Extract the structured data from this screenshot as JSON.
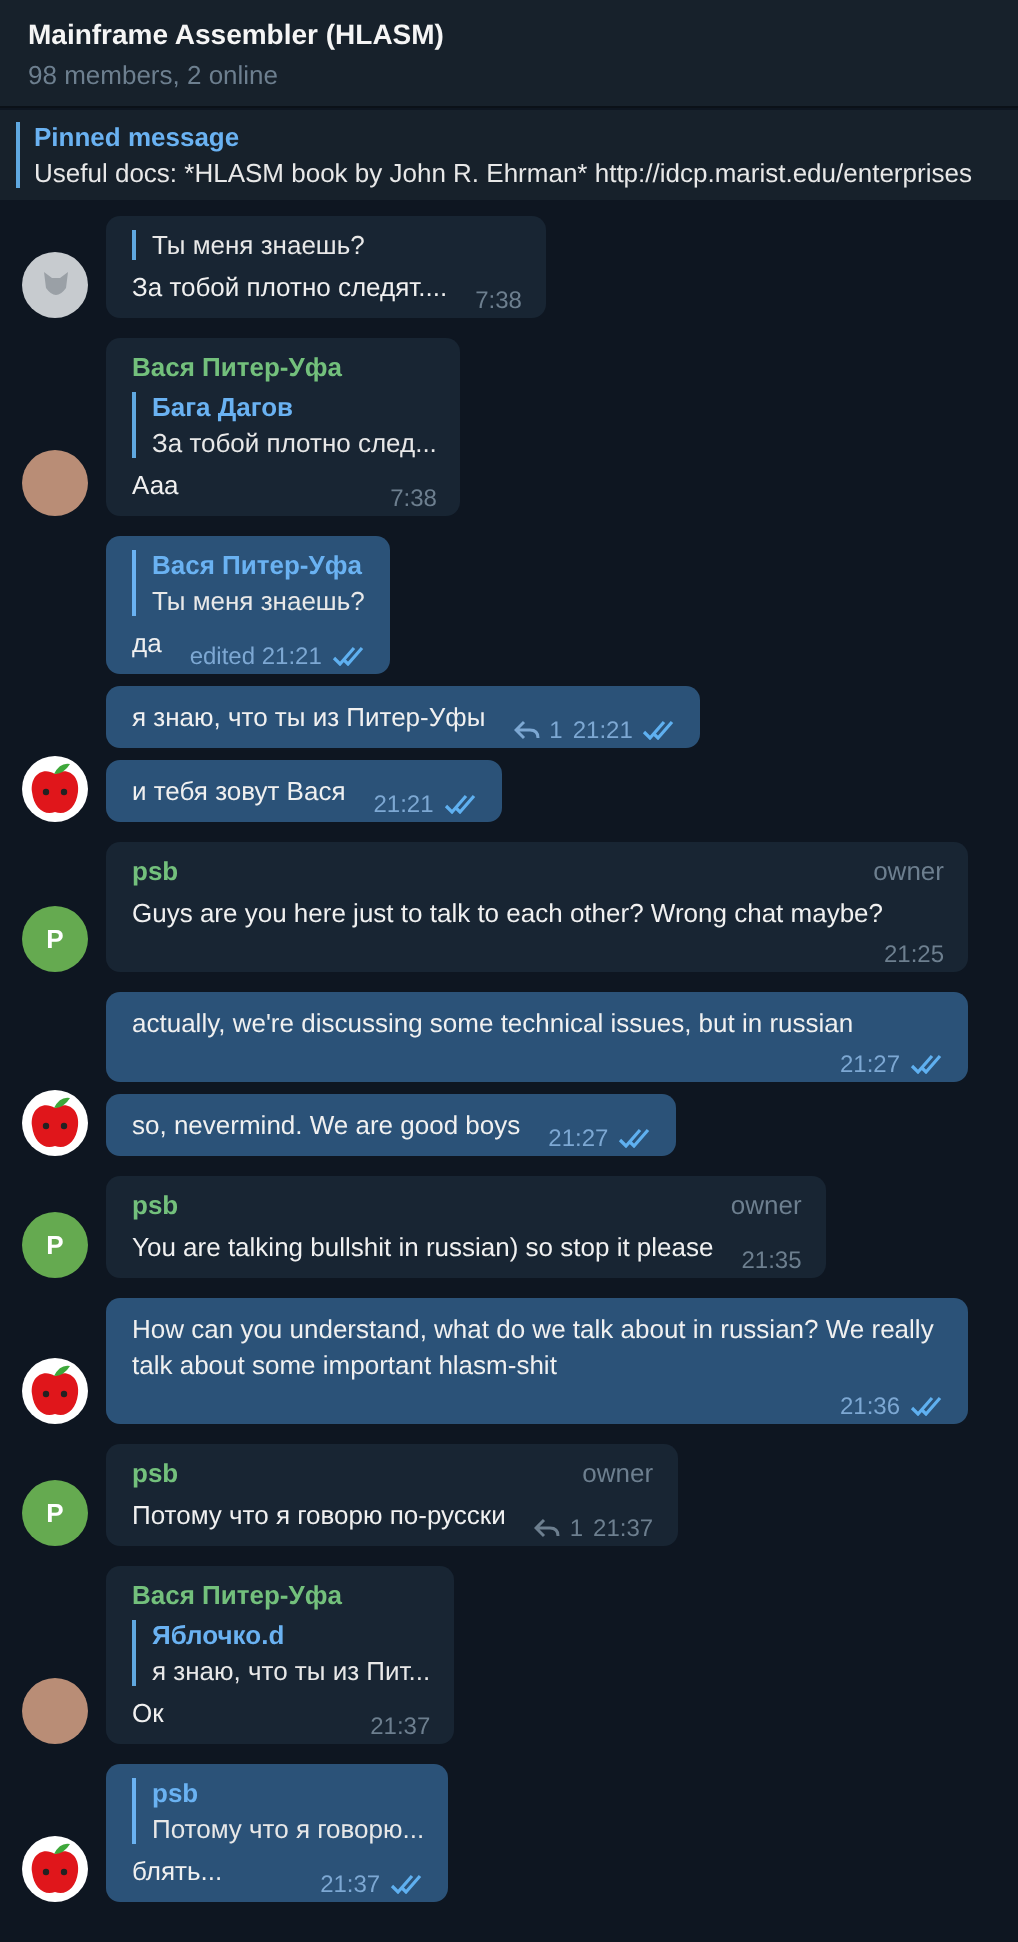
{
  "header": {
    "title": "Mainframe Assembler (HLASM)",
    "subtitle": "98 members, 2 online"
  },
  "pinned": {
    "label": "Pinned message",
    "text": "Useful docs:  *HLASM book by John R. Ehrman* http://idcp.marist.edu/enterprises"
  },
  "groups": [
    {
      "avatar": {
        "kind": "default"
      },
      "messages": [
        {
          "outgoing": false,
          "quote": {
            "text": "Ты меня знаешь?"
          },
          "text": "За тобой плотно следят....",
          "time": "7:38",
          "read": false
        }
      ]
    },
    {
      "avatar": {
        "kind": "photo"
      },
      "messages": [
        {
          "outgoing": false,
          "sender": "Вася Питер-Уфа",
          "quote": {
            "name": "Бага Дагов",
            "text": "За тобой плотно след..."
          },
          "text": "Ааа",
          "time": "7:38",
          "read": false
        }
      ]
    },
    {
      "avatar": {
        "kind": "apple"
      },
      "messages": [
        {
          "outgoing": true,
          "quote": {
            "name": "Вася Питер-Уфа",
            "text": "Ты меня знаешь?"
          },
          "text": "да",
          "edited": "edited",
          "time": "21:21",
          "read": true
        },
        {
          "outgoing": true,
          "text": "я знаю, что ты из Питер-Уфы",
          "replies": "1",
          "time": "21:21",
          "read": true
        },
        {
          "outgoing": true,
          "text": "и тебя зовут Вася",
          "time": "21:21",
          "read": true
        }
      ]
    },
    {
      "avatar": {
        "kind": "letter",
        "letter": "P"
      },
      "messages": [
        {
          "outgoing": false,
          "sender": "psb",
          "role": "owner",
          "text": "Guys are you here just to talk to each other? Wrong chat maybe?",
          "time": "21:25",
          "read": false
        }
      ]
    },
    {
      "avatar": {
        "kind": "apple"
      },
      "messages": [
        {
          "outgoing": true,
          "text": "actually, we're discussing some technical issues, but in russian",
          "time": "21:27",
          "read": true
        },
        {
          "outgoing": true,
          "text": "so, nevermind. We are good boys",
          "time": "21:27",
          "read": true
        }
      ]
    },
    {
      "avatar": {
        "kind": "letter",
        "letter": "P"
      },
      "messages": [
        {
          "outgoing": false,
          "sender": "psb",
          "role": "owner",
          "text": "You are talking bullshit in russian) so stop it please",
          "time": "21:35",
          "read": false
        }
      ]
    },
    {
      "avatar": {
        "kind": "apple"
      },
      "messages": [
        {
          "outgoing": true,
          "text": "How can you understand, what do we talk about in russian? We really talk about some important hlasm-shit",
          "time": "21:36",
          "read": true
        }
      ]
    },
    {
      "avatar": {
        "kind": "letter",
        "letter": "P"
      },
      "messages": [
        {
          "outgoing": false,
          "sender": "psb",
          "role": "owner",
          "text": "Потому что я говорю по-русски",
          "replies": "1",
          "time": "21:37",
          "read": false
        }
      ]
    },
    {
      "avatar": {
        "kind": "photo"
      },
      "messages": [
        {
          "outgoing": false,
          "sender": "Вася Питер-Уфа",
          "quote": {
            "name": "Яблочко.d",
            "text": "я знаю, что ты из Пит..."
          },
          "text": "Ок",
          "time": "21:37",
          "read": false
        }
      ]
    },
    {
      "avatar": {
        "kind": "apple"
      },
      "messages": [
        {
          "outgoing": true,
          "quote": {
            "name": "psb",
            "text": "Потому что я говорю..."
          },
          "text": "блять...",
          "time": "21:37",
          "read": true
        }
      ]
    }
  ]
}
